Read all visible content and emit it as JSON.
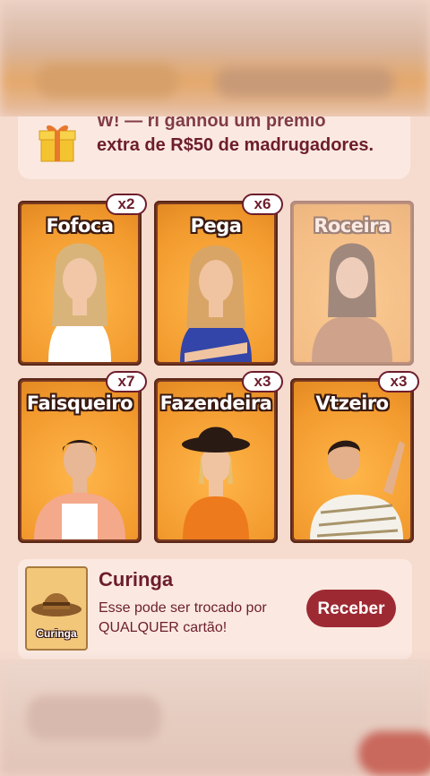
{
  "notice": {
    "text": "extra de R$50 de madrugadores.",
    "cut_line": "W! — ri ganhou um prêmio",
    "icon": "gift-icon"
  },
  "cards": [
    {
      "name": "Fofoca",
      "count": "x2",
      "owned": true
    },
    {
      "name": "Pega",
      "count": "x6",
      "owned": true
    },
    {
      "name": "Roceira",
      "count": "",
      "owned": false
    },
    {
      "name": "Faisqueiro",
      "count": "x7",
      "owned": true
    },
    {
      "name": "Fazendeira",
      "count": "x3",
      "owned": true
    },
    {
      "name": "Vtzeiro",
      "count": "x3",
      "owned": true
    }
  ],
  "wildcard": {
    "thumb_label": "Curinga",
    "title": "Curinga",
    "description": "Esse pode ser trocado por QUALQUER cartão!",
    "button": "Receber"
  },
  "colors": {
    "accent": "#9d2a33",
    "text": "#6d1d2c",
    "card_bg": "#f29a2e",
    "panel": "#f6dbcf"
  }
}
